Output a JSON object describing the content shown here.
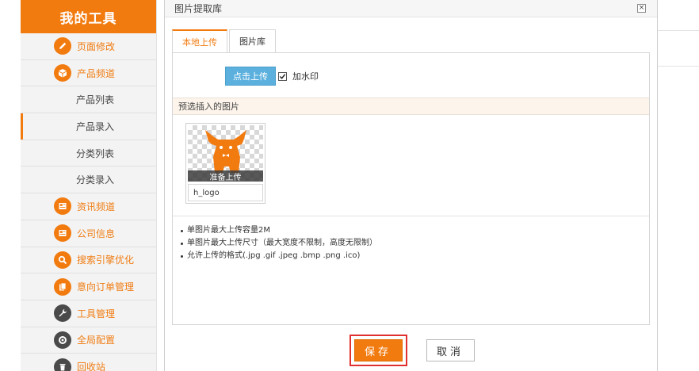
{
  "sidebar": {
    "title": "我的工具",
    "accent_color": "#f27b10",
    "items": [
      {
        "label": "页面修改",
        "icon": "pencil-icon",
        "kind": "main"
      },
      {
        "label": "产品频道",
        "icon": "box-icon",
        "kind": "main"
      },
      {
        "label": "产品列表",
        "kind": "sub"
      },
      {
        "label": "产品录入",
        "kind": "sub",
        "active": true
      },
      {
        "label": "分类列表",
        "kind": "sub"
      },
      {
        "label": "分类录入",
        "kind": "sub"
      },
      {
        "label": "资讯频道",
        "icon": "news-icon",
        "kind": "main"
      },
      {
        "label": "公司信息",
        "icon": "info-icon",
        "kind": "main"
      },
      {
        "label": "搜索引擎优化",
        "icon": "search-icon",
        "kind": "main"
      },
      {
        "label": "意向订单管理",
        "icon": "orders-icon",
        "kind": "main"
      },
      {
        "label": "工具管理",
        "icon": "wrench-icon",
        "kind": "main"
      },
      {
        "label": "全局配置",
        "icon": "gear-icon",
        "kind": "main"
      },
      {
        "label": "回收站",
        "icon": "trash-icon",
        "kind": "main"
      }
    ]
  },
  "modal": {
    "title": "图片提取库",
    "close_symbol": "×",
    "tabs": [
      "本地上传",
      "图片库"
    ],
    "upload_button": "点击上传",
    "watermark_label": "加水印",
    "watermark_checked": true,
    "preview_header": "预选插入的图片",
    "thumbnail": {
      "status": "准备上传",
      "name": "h_logo"
    },
    "notes": [
      "单图片最大上传容量2M",
      "单图片最大上传尺寸（最大宽度不限制，高度无限制）",
      "允许上传的格式(.jpg .gif .jpeg .bmp .png .ico)"
    ],
    "save_label": "保存",
    "cancel_label": "取消"
  }
}
